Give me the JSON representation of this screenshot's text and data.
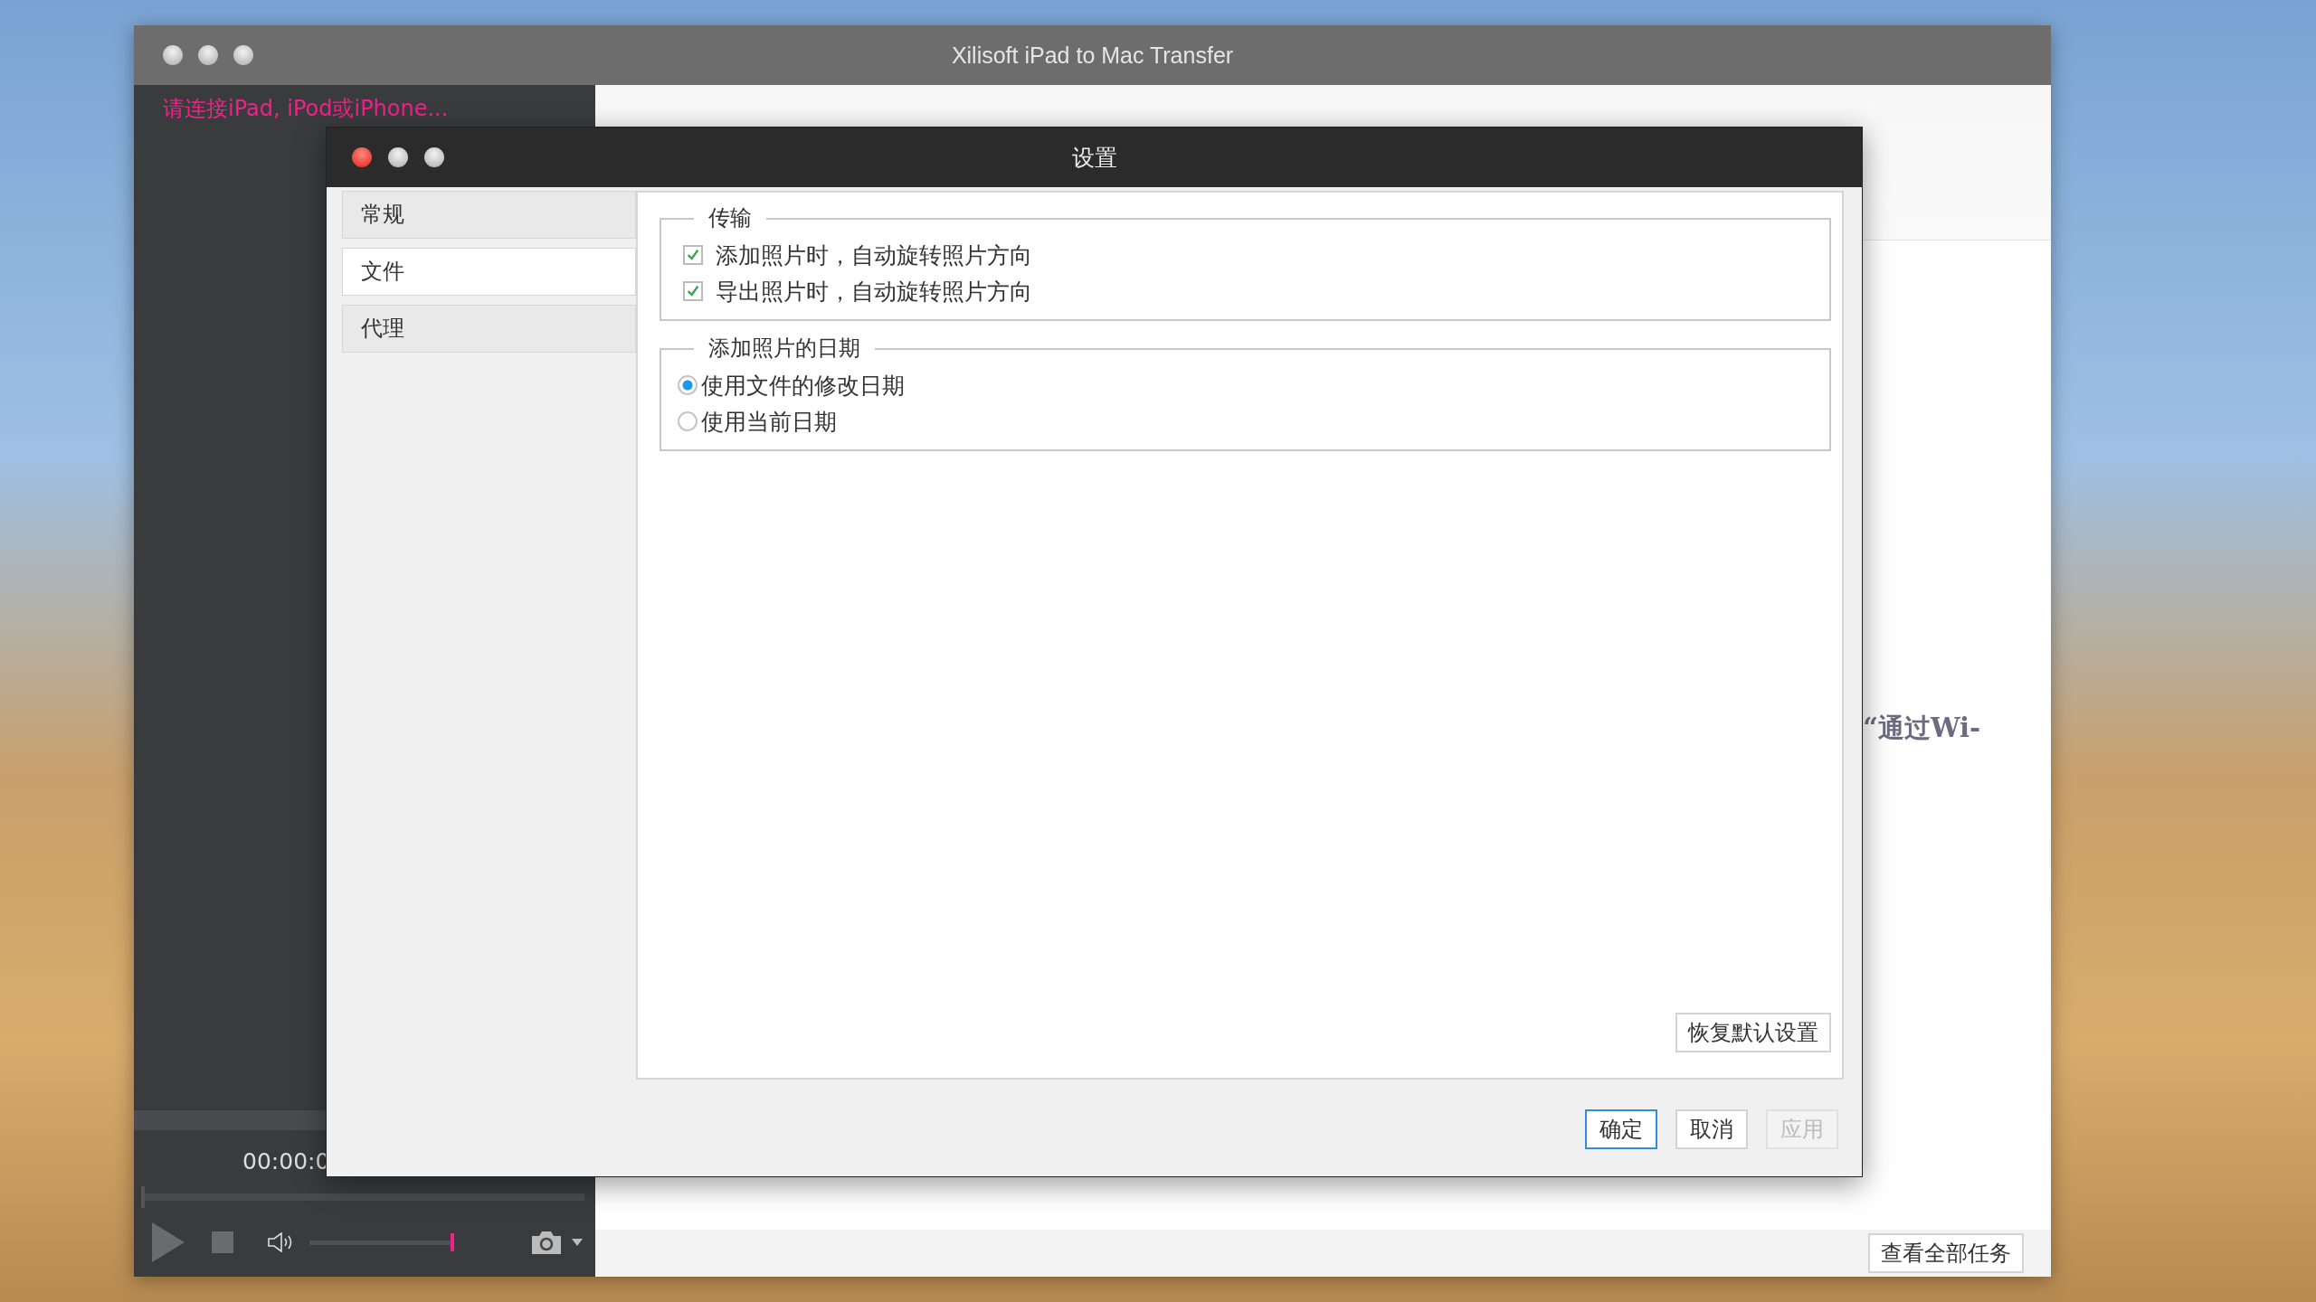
{
  "main_window": {
    "title": "Xilisoft iPad to Mac Transfer",
    "connect_prompt": "请连接iPad, iPod或iPhone...",
    "time": "00:00:0",
    "seek": {
      "level": 0
    },
    "volume": {
      "level": 1
    },
    "partial_text": "“通过Wi-",
    "view_all_tasks_button": "查看全部任务"
  },
  "dialog": {
    "title": "设置",
    "nav": [
      {
        "label": "常规",
        "selected": false
      },
      {
        "label": "文件",
        "selected": true
      },
      {
        "label": "代理",
        "selected": false
      }
    ],
    "transfer_group": {
      "legend": "传输",
      "options": [
        {
          "label": "添加照片时，自动旋转照片方向",
          "checked": true
        },
        {
          "label": "导出照片时，自动旋转照片方向",
          "checked": true
        }
      ]
    },
    "date_group": {
      "legend": "添加照片的日期",
      "options": [
        {
          "label": "使用文件的修改日期",
          "selected": true
        },
        {
          "label": "使用当前日期",
          "selected": false
        }
      ]
    },
    "restore_defaults_button": "恢复默认设置",
    "buttons": [
      {
        "label": "确定",
        "kind": "default",
        "disabled": false
      },
      {
        "label": "取消",
        "kind": "normal",
        "disabled": false
      },
      {
        "label": "应用",
        "kind": "normal",
        "disabled": true
      }
    ]
  }
}
